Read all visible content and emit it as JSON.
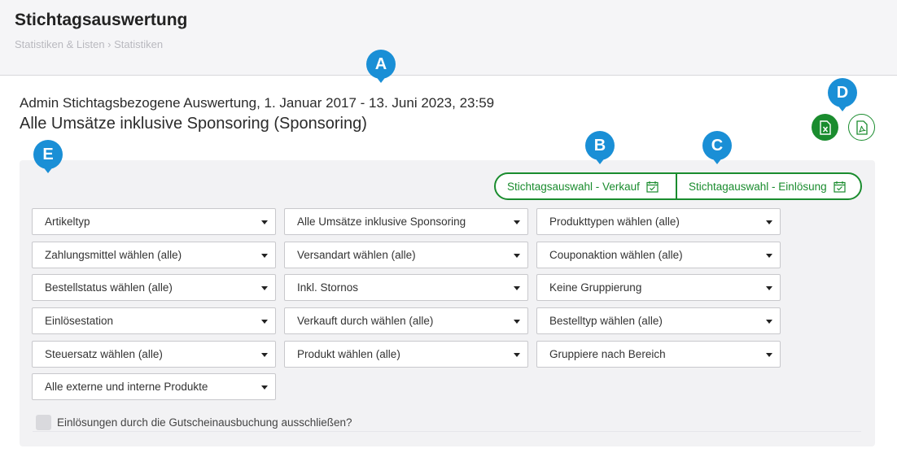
{
  "header": {
    "title": "Stichtagsauswertung",
    "breadcrumb": "Statistiken & Listen › Statistiken"
  },
  "report": {
    "subtitle": "Admin Stichtagsbezogene Auswertung, 1. Januar 2017 - 13. Juni 2023, 23:59",
    "title": "Alle Umsätze inklusive Sponsoring (Sponsoring)"
  },
  "export": {
    "excel_icon": "excel-file-icon",
    "pdf_icon": "pdf-file-icon"
  },
  "date_selection": {
    "sale_label": "Stichtagsauswahl - Verkauf",
    "redemption_label": "Stichtagauswahl - Einlösung",
    "icon": "calendar-check-icon"
  },
  "filters": {
    "col1": [
      "Artikeltyp",
      "Zahlungsmittel wählen (alle)",
      "Bestellstatus wählen (alle)",
      "Einlösestation",
      "Steuersatz wählen (alle)",
      "Alle externe und interne Produkte"
    ],
    "col2": [
      "Alle Umsätze inklusive Sponsoring",
      "Versandart wählen (alle)",
      "Inkl. Stornos",
      "Verkauft durch wählen (alle)",
      "Produkt wählen (alle)"
    ],
    "col3": [
      "Produkttypen wählen (alle)",
      "Couponaktion wählen (alle)",
      "Keine Gruppierung",
      "Bestelltyp wählen (alle)",
      "Gruppiere nach Bereich"
    ]
  },
  "checkbox": {
    "label": "Einlösungen durch die Gutscheinausbuchung ausschließen?"
  },
  "markers": {
    "a": "A",
    "b": "B",
    "c": "C",
    "d": "D",
    "e": "E"
  },
  "colors": {
    "accent_green": "#1a8c2e",
    "marker_blue": "#1a8fd6",
    "panel_bg": "#f2f2f4"
  }
}
